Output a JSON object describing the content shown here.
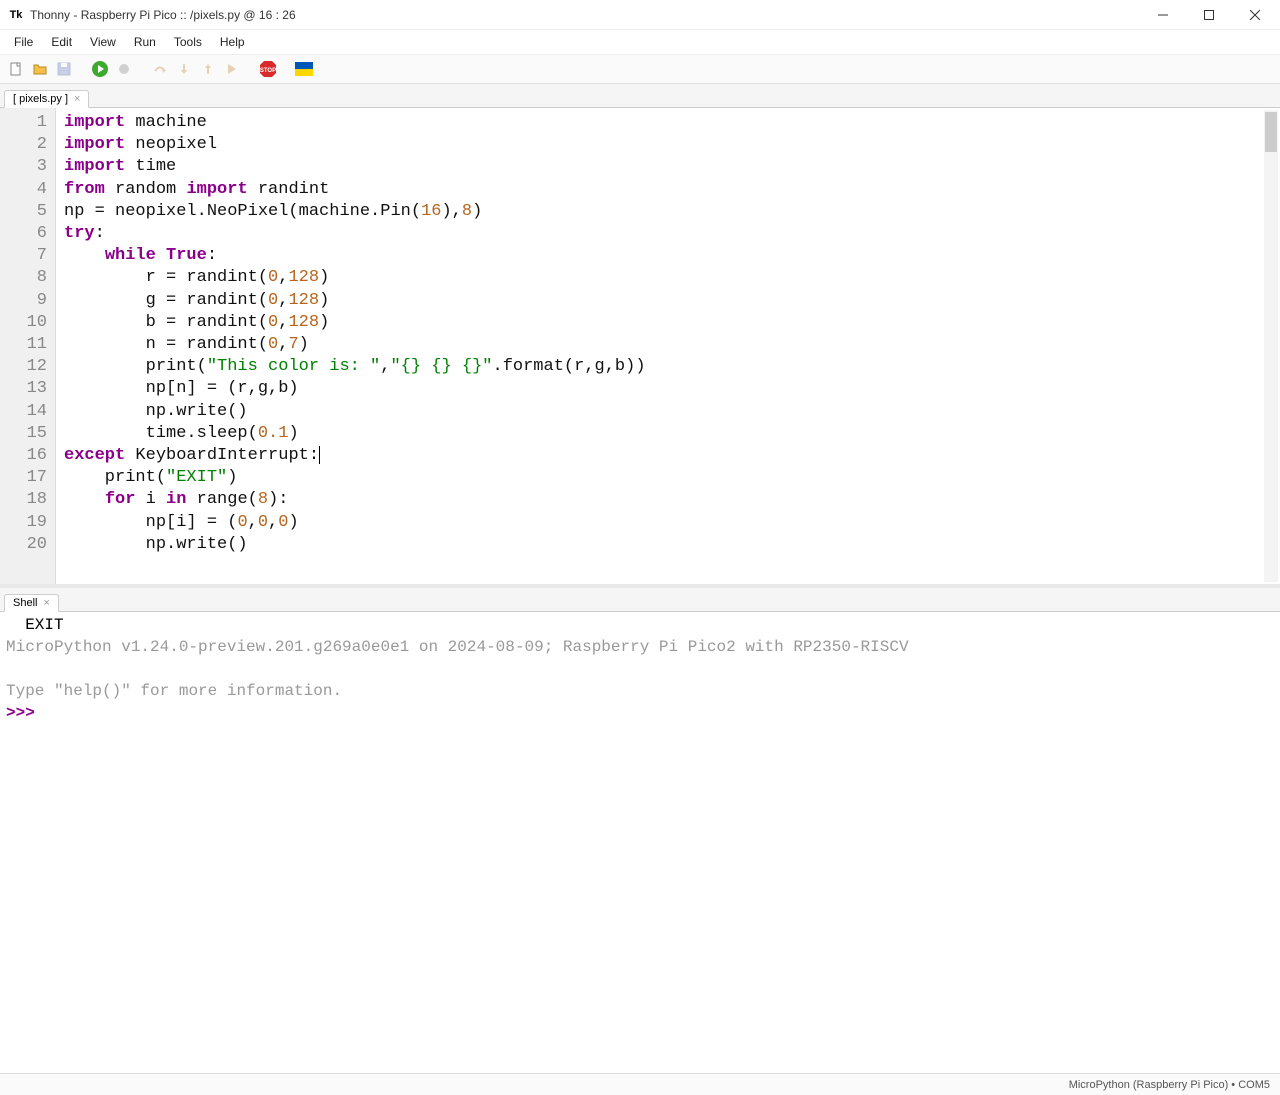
{
  "window": {
    "icon_text": "Tk",
    "title": "Thonny  -  Raspberry Pi Pico :: /pixels.py  @  16 : 26"
  },
  "menu": {
    "file": "File",
    "edit": "Edit",
    "view": "View",
    "run": "Run",
    "tools": "Tools",
    "help": "Help"
  },
  "tab": {
    "label": "[ pixels.py ]"
  },
  "shelltab": {
    "label": "Shell"
  },
  "code": {
    "lines": [
      1,
      2,
      3,
      4,
      5,
      6,
      7,
      8,
      9,
      10,
      11,
      12,
      13,
      14,
      15,
      16,
      17,
      18,
      19,
      20
    ],
    "l1_kw": "import",
    "l1_rest": " machine",
    "l2_kw": "import",
    "l2_rest": " neopixel",
    "l3_kw": "import",
    "l3_rest": " time",
    "l4_a": "from",
    "l4_b": " random ",
    "l4_c": "import",
    "l4_d": " randint",
    "l5_a": "np = neopixel.NeoPixel(machine.Pin(",
    "l5_n1": "16",
    "l5_b": "),",
    "l5_n2": "8",
    "l5_c": ")",
    "l6_kw": "try",
    "l6_b": ":",
    "l7_a": "    ",
    "l7_kw": "while",
    "l7_b": " ",
    "l7_kw2": "True",
    "l7_c": ":",
    "l8_a": "        r = randint(",
    "l8_n1": "0",
    "l8_b": ",",
    "l8_n2": "128",
    "l8_c": ")",
    "l9_a": "        g = randint(",
    "l9_n1": "0",
    "l9_b": ",",
    "l9_n2": "128",
    "l9_c": ")",
    "l10_a": "        b = randint(",
    "l10_n1": "0",
    "l10_b": ",",
    "l10_n2": "128",
    "l10_c": ")",
    "l11_a": "        n = randint(",
    "l11_n1": "0",
    "l11_b": ",",
    "l11_n2": "7",
    "l11_c": ")",
    "l12_a": "        print(",
    "l12_s1": "\"This color is: \"",
    "l12_b": ",",
    "l12_s2": "\"{} {} {}\"",
    "l12_c": ".format(r,g,b))",
    "l13": "        np[n] = (r,g,b)",
    "l14": "        np.write()",
    "l15_a": "        time.sleep(",
    "l15_n": "0.1",
    "l15_b": ")",
    "l16_kw": "except",
    "l16_b": " KeyboardInterrupt:",
    "l17_a": "    print(",
    "l17_s": "\"EXIT\"",
    "l17_b": ")",
    "l18_a": "    ",
    "l18_kw": "for",
    "l18_b": " i ",
    "l18_kw2": "in",
    "l18_c": " range(",
    "l18_n": "8",
    "l18_d": "):",
    "l19_a": "        np[i] = (",
    "l19_n1": "0",
    "l19_b": ",",
    "l19_n2": "0",
    "l19_c": ",",
    "l19_n3": "0",
    "l19_d": ")",
    "l20": "        np.write()"
  },
  "shell": {
    "l1": "  EXIT",
    "l2": "MicroPython v1.24.0-preview.201.g269a0e0e1 on 2024-08-09; Raspberry Pi Pico2 with RP2350-RISCV",
    "l3a": "Type ",
    "l3b": "\"help()\"",
    "l3c": " for more information.",
    "prompt": ">>> "
  },
  "status": {
    "text": "MicroPython (Raspberry Pi Pico)  •  COM5"
  }
}
